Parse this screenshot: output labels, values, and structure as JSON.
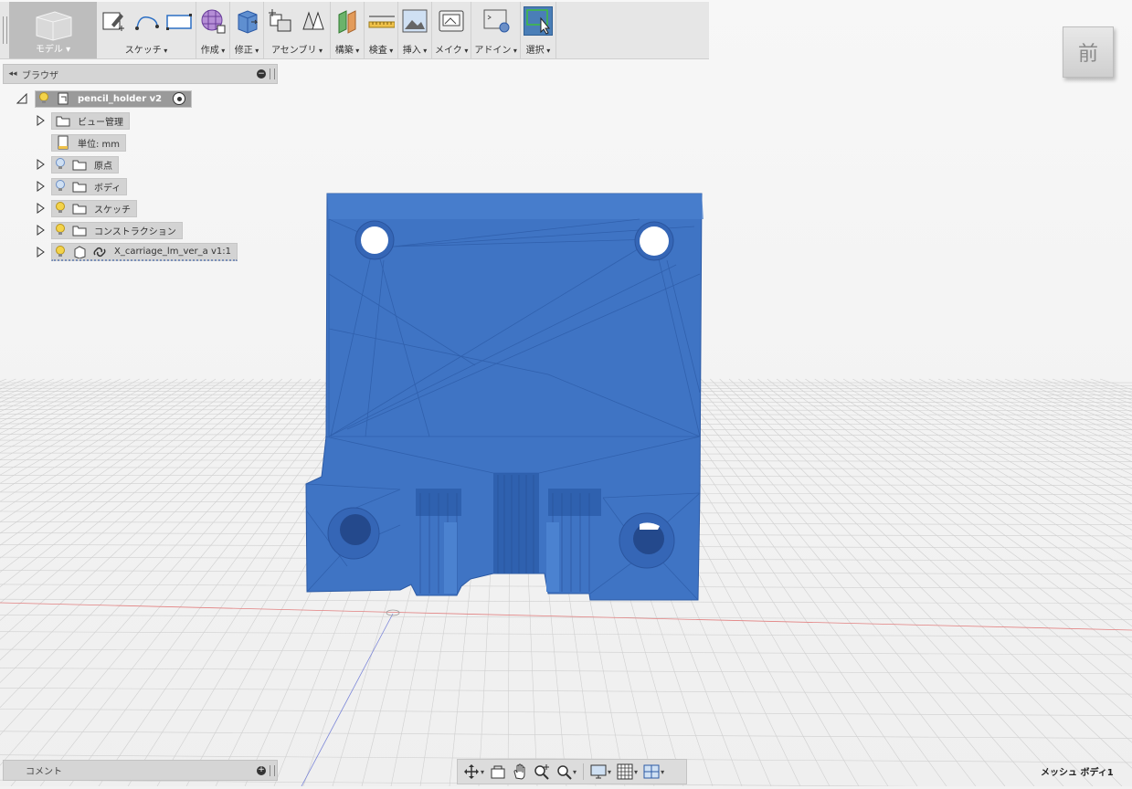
{
  "toolbar": {
    "workspace_label": "モデル",
    "groups": [
      {
        "label": "スケッチ",
        "icons": [
          "create-sketch-icon",
          "line-icon",
          "rectangle-icon"
        ]
      },
      {
        "label": "作成",
        "icons": [
          "create-form-icon"
        ]
      },
      {
        "label": "修正",
        "icons": [
          "press-pull-icon"
        ]
      },
      {
        "label": "アセンブリ",
        "icons": [
          "new-component-icon",
          "joint-icon"
        ]
      },
      {
        "label": "構築",
        "icons": [
          "offset-plane-icon"
        ]
      },
      {
        "label": "検査",
        "icons": [
          "measure-icon"
        ]
      },
      {
        "label": "挿入",
        "icons": [
          "insert-image-icon"
        ]
      },
      {
        "label": "メイク",
        "icons": [
          "3d-print-icon"
        ]
      },
      {
        "label": "アドイン",
        "icons": [
          "scripts-addins-icon"
        ]
      },
      {
        "label": "選択",
        "icons": [
          "window-select-icon"
        ]
      }
    ]
  },
  "browser": {
    "title": "ブラウザ",
    "root": "pencil_holder v2",
    "items": [
      {
        "label": "ビュー管理",
        "bulb": "none",
        "folder": true
      },
      {
        "label": "単位: mm",
        "bulb": "none",
        "folder": false
      },
      {
        "label": "原点",
        "bulb": "off",
        "folder": true
      },
      {
        "label": "ボディ",
        "bulb": "off",
        "folder": true
      },
      {
        "label": "スケッチ",
        "bulb": "on",
        "folder": true
      },
      {
        "label": "コンストラクション",
        "bulb": "on",
        "folder": true
      },
      {
        "label": "X_carriage_lm_ver_a v1:1",
        "bulb": "on",
        "folder": false
      }
    ]
  },
  "viewcube": {
    "face_label": "前"
  },
  "comments": {
    "title": "コメント"
  },
  "status": {
    "selection": "メッシュ ボディ1"
  },
  "colors": {
    "model_fill": "#3f74c4",
    "grid_line": "#d0d0d0",
    "toolbar_bg": "#e6e6e6",
    "select_active": "#4a7eb7"
  }
}
